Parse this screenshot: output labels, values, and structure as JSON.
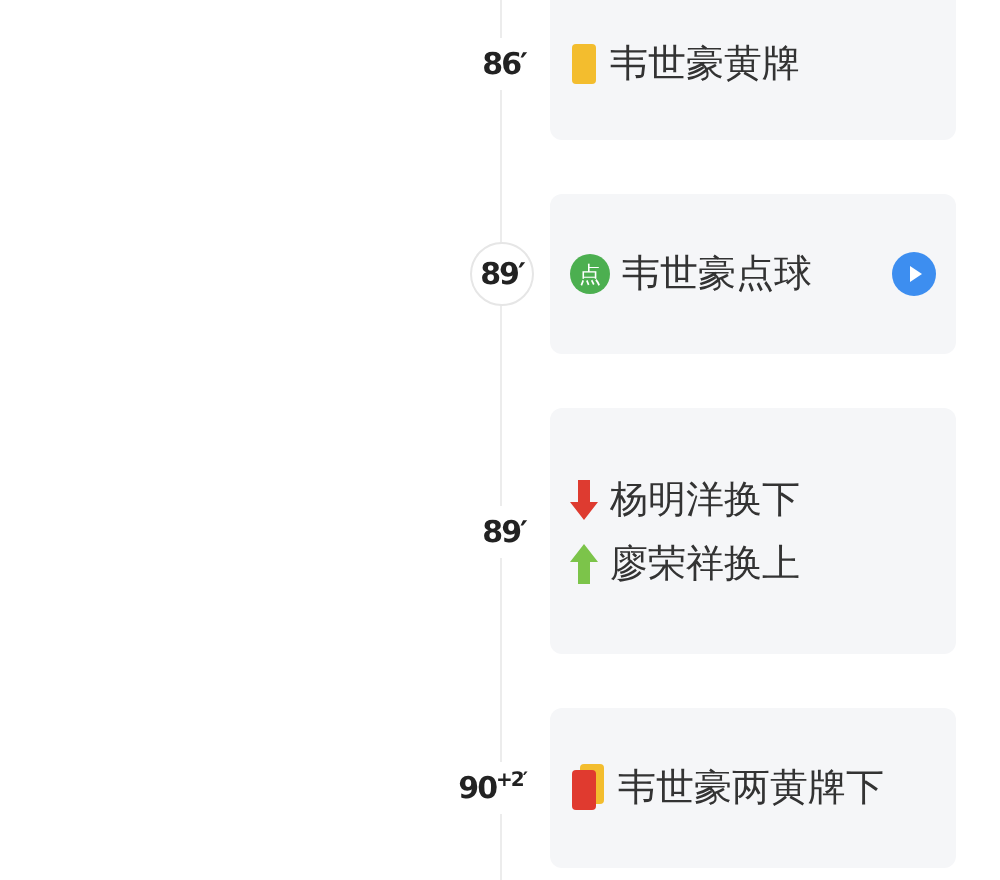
{
  "events": [
    {
      "minute": "86′",
      "kind": "yellow_card",
      "video": false,
      "lines": [
        {
          "text": "韦世豪黄牌"
        }
      ]
    },
    {
      "minute": "89′",
      "kind": "penalty",
      "badge": "点",
      "video": true,
      "lines": [
        {
          "text": "韦世豪点球"
        }
      ]
    },
    {
      "minute": "89′",
      "kind": "substitution",
      "video": false,
      "lines": [
        {
          "kind": "out",
          "text": "杨明洋换下"
        },
        {
          "kind": "in",
          "text": "廖荣祥换上"
        }
      ]
    },
    {
      "minute": "90$^{+2′}$",
      "kind": "second_yellow",
      "video": false,
      "lines": [
        {
          "text": "韦世豪两黄牌下"
        }
      ]
    }
  ]
}
